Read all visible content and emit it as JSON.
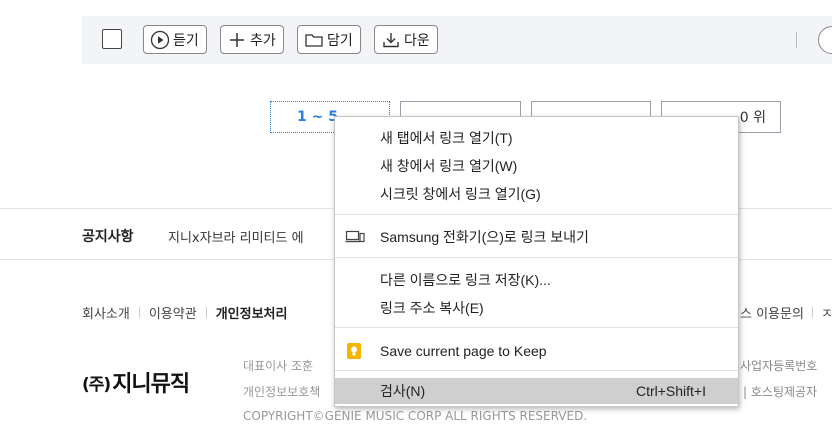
{
  "toolbar": {
    "listen": "듣기",
    "add": "추가",
    "save": "담기",
    "download": "다운"
  },
  "rank_tabs": {
    "first": "1 ~ 5",
    "last": "0 위"
  },
  "notice": {
    "title": "공지사항",
    "text": "지니x자브라 리미티드 에"
  },
  "footer": {
    "links": [
      "회사소개",
      "이용약관",
      "개인정보처리"
    ],
    "links_right": [
      "스 이용문의",
      "ㅈ"
    ],
    "logo_prefix": "(주)",
    "logo_text": "지니뮤직",
    "info_line1": "대표이사 조훈",
    "info_line2": "개인정보보호책",
    "copyright": "COPYRIGHT©GENIE MUSIC CORP ALL RIGHTS RESERVED.",
    "right_line1": "사업자등록번호",
    "right_line2": "| 호스팅제공자"
  },
  "context_menu": {
    "items": [
      {
        "label": "새 탭에서 링크 열기(T)"
      },
      {
        "label": "새 창에서 링크 열기(W)"
      },
      {
        "label": "시크릿 창에서 링크 열기(G)"
      },
      {
        "label": "Samsung 전화기(으)로 링크 보내기",
        "icon": "device-icon"
      },
      {
        "label": "다른 이름으로 링크 저장(K)..."
      },
      {
        "label": "링크 주소 복사(E)"
      },
      {
        "label": "Save current page to Keep",
        "icon": "keep-icon"
      },
      {
        "label": "검사(N)",
        "shortcut": "Ctrl+Shift+I",
        "highlighted": true
      }
    ]
  },
  "colors": {
    "accent": "#2a7de1",
    "keep_icon": "#f6b400",
    "highlight": "#cfcfcf",
    "toolbar_bg": "#f3f4f7"
  }
}
